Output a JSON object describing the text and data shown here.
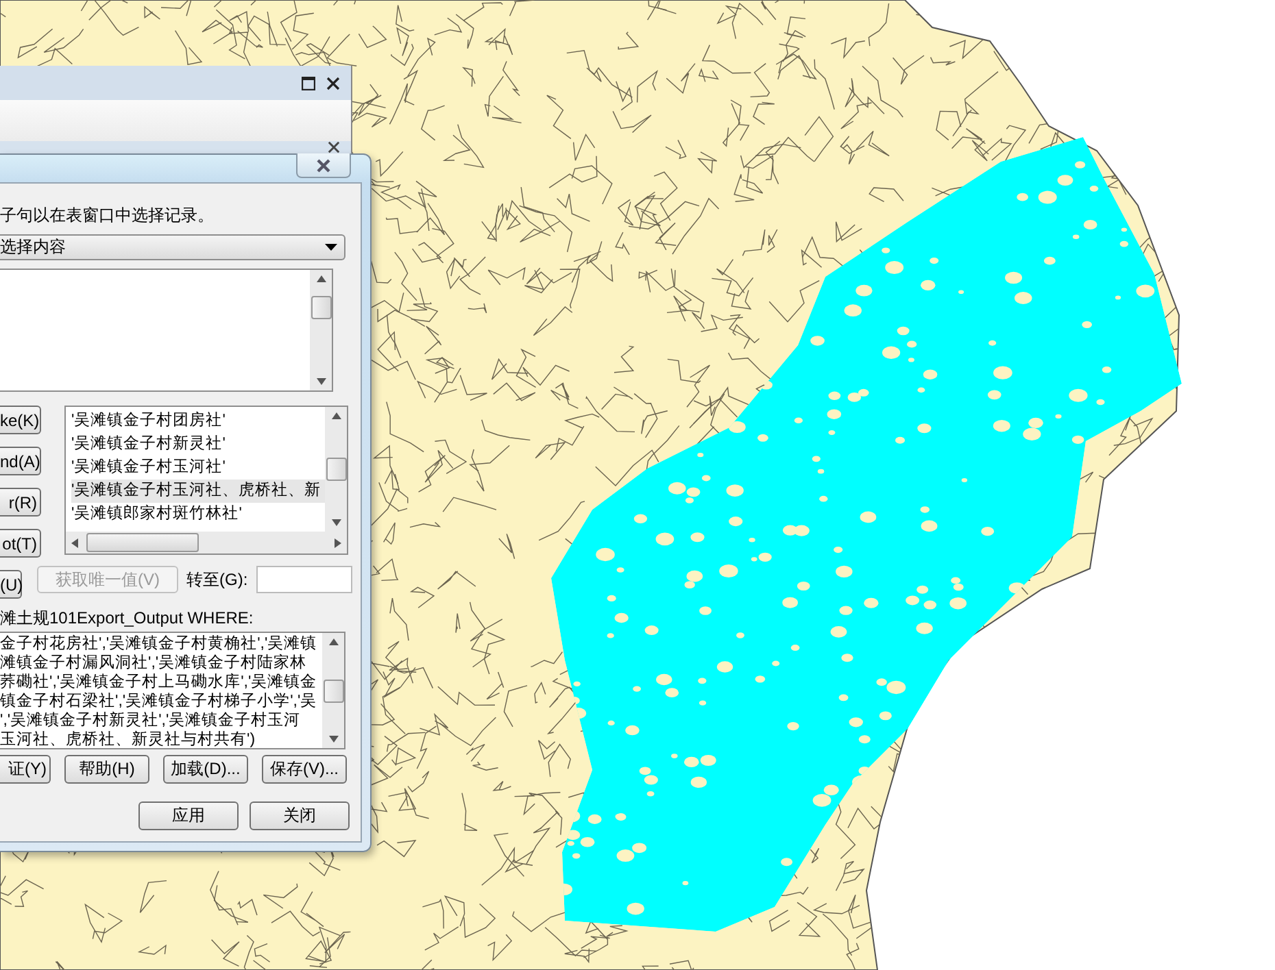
{
  "dialog": {
    "instruction": "子句以在表窗口中选择记录。",
    "method": "选择内容",
    "operator_buttons": [
      "ke(K)",
      "nd(A)",
      "r(R)",
      "ot(T)",
      "(U)"
    ],
    "values": [
      {
        "label": "'吴滩镇金子村团房社'",
        "selected": false
      },
      {
        "label": "'吴滩镇金子村新灵社'",
        "selected": false
      },
      {
        "label": "'吴滩镇金子村玉河社'",
        "selected": false
      },
      {
        "label": "'吴滩镇金子村玉河社、虎桥社、新",
        "selected": true
      },
      {
        "label": "'吴滩镇郎家村斑竹林社'",
        "selected": false
      }
    ],
    "unique_button": {
      "label": "获取唯一值(V)",
      "disabled": true
    },
    "goto_label": "转至(G):",
    "where_label": "滩土规101Export_Output WHERE:",
    "expression_lines": [
      "金子村花房社','吴滩镇金子村黄桷社','吴滩镇",
      "滩镇金子村漏风洞社','吴滩镇金子村陆家林",
      "荞磡社','吴滩镇金子村上马磡水库','吴滩镇金",
      "镇金子村石梁社','吴滩镇金子村梯子小学','吴",
      "','吴滩镇金子村新灵社','吴滩镇金子村玉河",
      "玉河社、虎桥社、新灵社与村共有')"
    ],
    "action_buttons": [
      "证(Y)",
      "帮助(H)",
      "加载(D)...",
      "保存(V)..."
    ],
    "footer_buttons": [
      "应用",
      "关闭"
    ]
  }
}
